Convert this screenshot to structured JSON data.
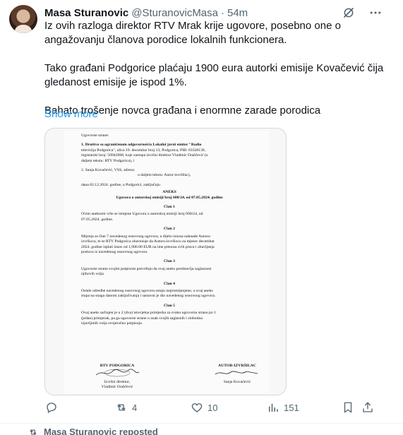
{
  "tweet": {
    "author_name": "Masa Sturanovic",
    "author_handle": "@SturanovicMasa",
    "separator": "·",
    "time": "54m",
    "paragraphs": [
      "Iz ovih razloga direktor RTV Mrak krije ugovore, posebno one o angažovanju članova porodice lokalnih funkcionera.",
      "Tako građani Podgorice plaćaju 1900 eura autorki emisije Kovačević čija gledanost emisije je ispod 1%.",
      "Bahato trošenje novca građana i enormne zarade porodica"
    ],
    "show_more": "Show more"
  },
  "document": {
    "lines_top": [
      "Ugovorne strane:",
      "1. Društvo sa ograničenom odgovornošću Lokalni javni emiter \"Radio",
      "televizija Podgorica\", ulica 19. decembar broj 13, Podgorica, PIB: 03328139,",
      "registarski broj: 50942068, koje zastupa izvršni direktor Vladimir Oraščević (u",
      "daljem tekstu: RTV Podgorica), i",
      "2. Sanja Kovačević, VSS, adresa:",
      "u daljem tekstu: Autor-izvršilac),",
      "dana 02.12.2024. godine, u Podgorici, zaključuju"
    ],
    "title": "ANEKS",
    "subtitle": "Ugovora o autorskoj emisiji broj 600/24, od 07.05.2024. godine",
    "articles": [
      {
        "heading": "Član 1",
        "lines": [
          "Ovim aneksom vrše se izmjene Ugovora o autorskoj emisiji broj 600/24, od",
          "07.05.2024. godine."
        ]
      },
      {
        "heading": "Član 2",
        "lines": [
          "Mijenja se član 7 navedenog osnovnog ugovora, u dijelu iznosa naknade Autora-",
          "izvršioca, te se RTV Podgorica obavezuje da Autoru-izvršiocu za mjesec decembar",
          "2024. godine isplati iznos od 1,900.00 EUR na ime prenosa svih prava i obavljanja",
          "poslova iz navedenog osnovnog ugovora."
        ]
      },
      {
        "heading": "Član 3",
        "lines": [
          "Ugovorne strane svojim potpisom potvrđuju da ovaj aneks predstavlja saglasnost",
          "njihovih volja."
        ]
      },
      {
        "heading": "Član 4",
        "lines": [
          "Ostale odredbe navedenog osnovnog ugovora ostaju nepromijenjene, a ovaj aneks",
          "stupa na snagu danom zaključivanja i sastavni je dio navedenog osnovnog ugovora."
        ]
      },
      {
        "heading": "Član 5",
        "lines": [
          "Ovaj aneks sačinjen je u 2 (dva) istovjetna primjerka za svaku ugovornu stranu po 1",
          "(jedan) primjerak, pa ga ugovorne strane u znak svojih saglasnih i slobodno",
          "izjavljenih volja svojeručno potpisuju."
        ]
      }
    ],
    "sig_left_title": "RTV PODGORICA",
    "sig_left_role": "Izvršni direktor,",
    "sig_left_name": "Vladimir Oraščević",
    "sig_right_title": "AUTOR-IZVRŠILAC",
    "sig_right_name": "Sanja Kovačević"
  },
  "actions": {
    "reply_count": "",
    "repost_count": "4",
    "like_count": "10",
    "views_count": "151"
  },
  "next_item": {
    "reposted_label": "Masa Sturanovic reposted"
  },
  "colors": {
    "accent": "#1d9bf0",
    "muted": "#536471",
    "text": "#0f1419"
  }
}
